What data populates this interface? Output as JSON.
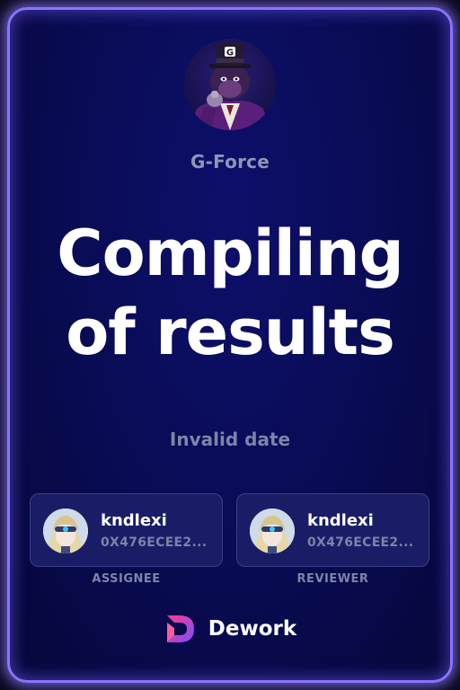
{
  "org": {
    "name": "G-Force",
    "avatar": "gorilla-avatar"
  },
  "task": {
    "title_line1": "Compiling",
    "title_line2": "of results",
    "date": "Invalid date"
  },
  "assignee": {
    "name": "kndlexi",
    "address": "0X476ECEE2...",
    "role": "ASSIGNEE",
    "avatar": "user-avatar"
  },
  "reviewer": {
    "name": "kndlexi",
    "address": "0X476ECEE2...",
    "role": "REVIEWER",
    "avatar": "user-avatar"
  },
  "brand": {
    "name": "Dework",
    "logo": "dework-logo-icon"
  },
  "colors": {
    "border_glow": "#8a73ff",
    "background": "#090b52",
    "logo_gradient_start": "#ff3d8b",
    "logo_gradient_end": "#7b4dff"
  }
}
